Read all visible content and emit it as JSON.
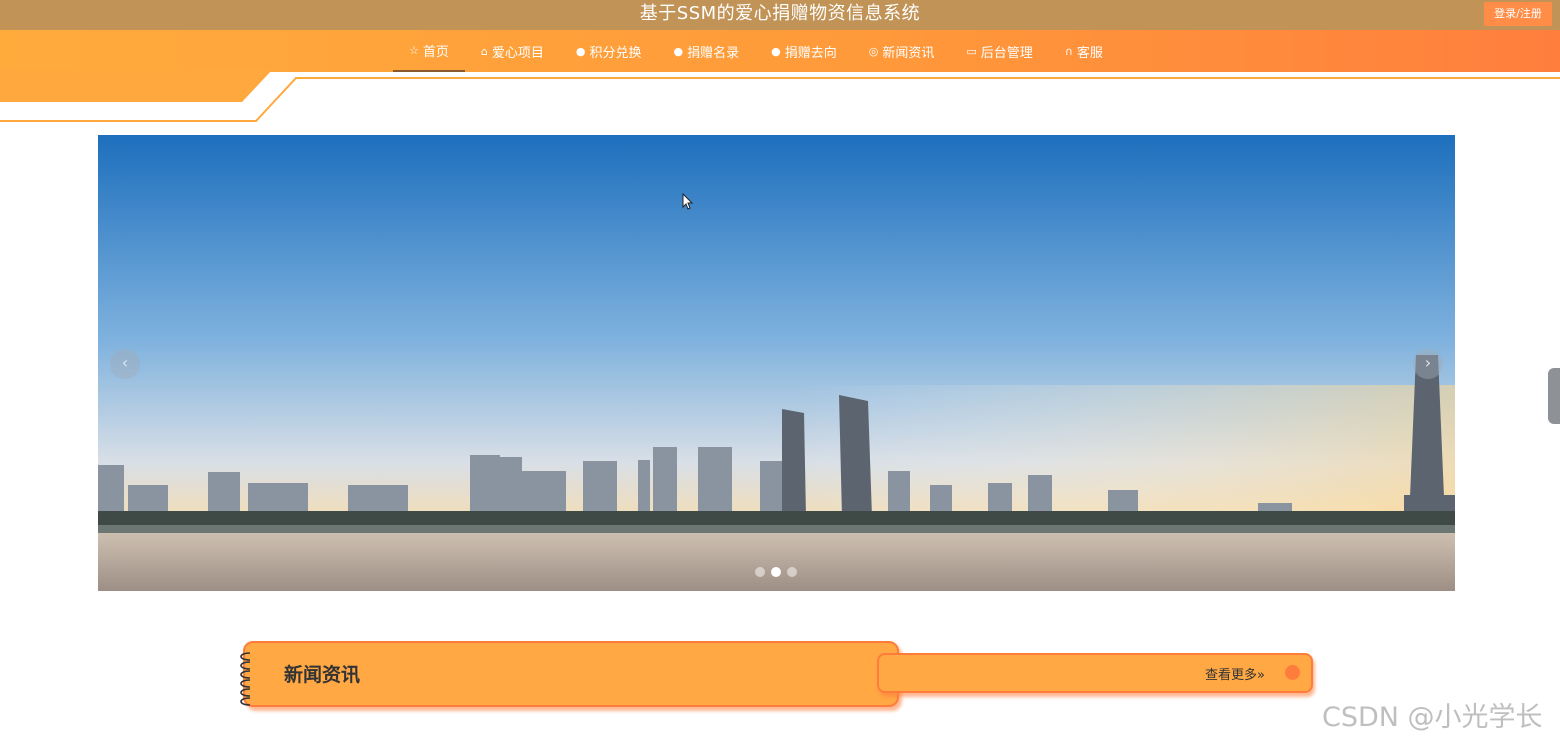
{
  "header": {
    "site_title": "基于SSM的爱心捐赠物资信息系统",
    "login_label": "登录/注册"
  },
  "nav": {
    "items": [
      {
        "label": "首页",
        "icon": "star-icon",
        "glyph": "☆"
      },
      {
        "label": "爱心项目",
        "icon": "bag-icon",
        "glyph": "⌂"
      },
      {
        "label": "积分兑换",
        "icon": "exclamation-circle-icon",
        "glyph": "●"
      },
      {
        "label": "捐赠名录",
        "icon": "question-circle-icon",
        "glyph": "●"
      },
      {
        "label": "捐赠去向",
        "icon": "info-circle-icon",
        "glyph": "●"
      },
      {
        "label": "新闻资讯",
        "icon": "globe-icon",
        "glyph": "◎"
      },
      {
        "label": "后台管理",
        "icon": "briefcase-icon",
        "glyph": "▭"
      },
      {
        "label": "客服",
        "icon": "headset-icon",
        "glyph": "∩"
      }
    ],
    "active_index": 0
  },
  "banner": {
    "prev_label": "‹",
    "next_label": "›",
    "slide_count": 3,
    "active_slide": 1
  },
  "news": {
    "title": "新闻资讯",
    "more_label": "查看更多»"
  },
  "watermark": "CSDN @小光学长",
  "colors": {
    "title_bar": "#c19356",
    "nav_orange": "#ff9a3a",
    "accent": "#ff7d3c",
    "panel": "#ffa844"
  }
}
